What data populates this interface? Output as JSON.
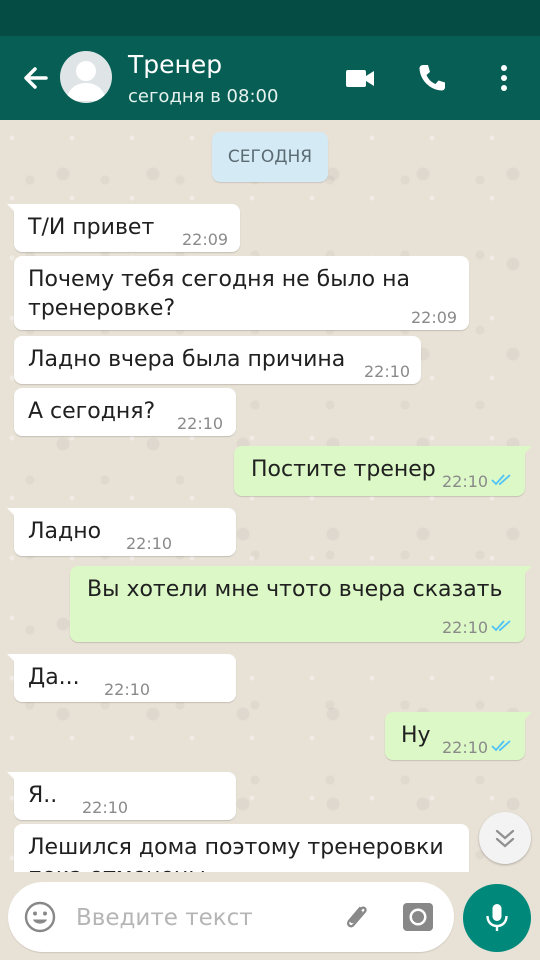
{
  "colors": {
    "header": "#075e54",
    "status_bar": "#054d44",
    "incoming_bubble": "#ffffff",
    "outgoing_bubble": "#dcf8c6",
    "read_ticks": "#4fc3f7",
    "mic_button": "#00897b"
  },
  "header": {
    "contact_name": "Тренер",
    "contact_status": "сегодня в 08:00",
    "icons": [
      "back-arrow-icon",
      "avatar-placeholder-icon",
      "video-call-icon",
      "phone-call-icon",
      "more-vertical-icon"
    ]
  },
  "date_chip": "СЕГОДНЯ",
  "messages": [
    {
      "direction": "in",
      "text": "Т/И привет",
      "time": "22:09"
    },
    {
      "direction": "in",
      "text": "Почему тебя сегодня не было на\nтренеровке?",
      "time": "22:09"
    },
    {
      "direction": "in",
      "text": "Ладно вчера была причина",
      "time": "22:10"
    },
    {
      "direction": "in",
      "text": "А сегодня?",
      "time": "22:10"
    },
    {
      "direction": "out",
      "text": "Постите тренер",
      "time": "22:10",
      "status": "read"
    },
    {
      "direction": "in",
      "text": "Ладно",
      "time": "22:10"
    },
    {
      "direction": "out",
      "text": "Вы хотели мне чтото вчера сказать",
      "time": "22:10",
      "status": "read"
    },
    {
      "direction": "in",
      "text": "Да...",
      "time": "22:10"
    },
    {
      "direction": "out",
      "text": "Ну",
      "time": "22:10",
      "status": "read"
    },
    {
      "direction": "in",
      "text": "Я..",
      "time": "22:10"
    },
    {
      "direction": "in",
      "text": "Лешился дома поэтому тренеровки\nпока отменены",
      "time": ""
    }
  ],
  "input": {
    "placeholder": "Введите текст",
    "value": "",
    "icons": [
      "emoji-icon",
      "attach-paperclip-icon",
      "camera-icon",
      "microphone-icon",
      "scroll-down-chevron-icon"
    ]
  }
}
